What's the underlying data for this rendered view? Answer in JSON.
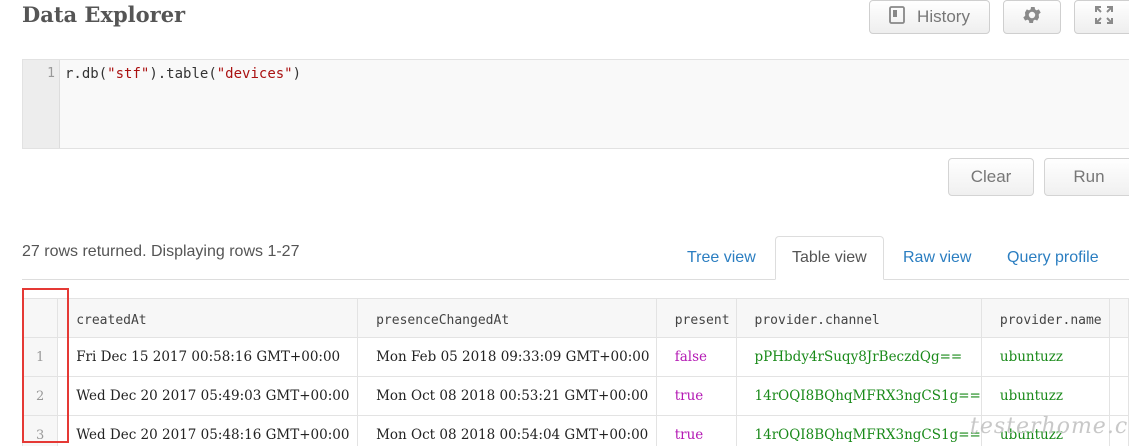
{
  "header": {
    "title": "Data Explorer",
    "history_label": "History",
    "history_icon": "history-icon",
    "settings_icon": "gear-icon",
    "fullscreen_icon": "fullscreen-icon"
  },
  "editor": {
    "line_number": "1",
    "code_prefix": "r.db(",
    "code_db": "\"stf\"",
    "code_mid": ").table(",
    "code_table": "\"devices\"",
    "code_suffix": ")"
  },
  "actions": {
    "clear_label": "Clear",
    "run_label": "Run"
  },
  "results": {
    "status": "27 rows returned. Displaying rows 1-27",
    "tabs": [
      {
        "label": "Tree view"
      },
      {
        "label": "Table view"
      },
      {
        "label": "Raw view"
      },
      {
        "label": "Query profile"
      }
    ],
    "columns": [
      "createdAt",
      "presenceChangedAt",
      "present",
      "provider.channel",
      "provider.name"
    ],
    "rows": [
      {
        "n": "1",
        "createdAt": "Fri Dec 15 2017 00:58:16 GMT+00:00",
        "presenceChangedAt": "Mon Feb 05 2018 09:33:09 GMT+00:00",
        "present": "false",
        "channel": "pPHbdy4rSuqy8JrBeczdQg==",
        "name": "ubuntuzz"
      },
      {
        "n": "2",
        "createdAt": "Wed Dec 20 2017 05:49:03 GMT+00:00",
        "presenceChangedAt": "Mon Oct 08 2018 00:53:21 GMT+00:00",
        "present": "true",
        "channel": "14rOQI8BQhqMFRX3ngCS1g==",
        "name": "ubuntuzz"
      },
      {
        "n": "3",
        "createdAt": "Wed Dec 20 2017 05:48:16 GMT+00:00",
        "presenceChangedAt": "Mon Oct 08 2018 00:54:04 GMT+00:00",
        "present": "true",
        "channel": "14rOQI8BQhqMFRX3ngCS1g==",
        "name": "ubuntuzz"
      }
    ]
  },
  "watermark": "testerhome.com",
  "colors": {
    "link": "#2b7ec1",
    "bool_value": "#b41ab4",
    "string_value": "#1a8a1a",
    "highlight_box": "#e53935"
  }
}
